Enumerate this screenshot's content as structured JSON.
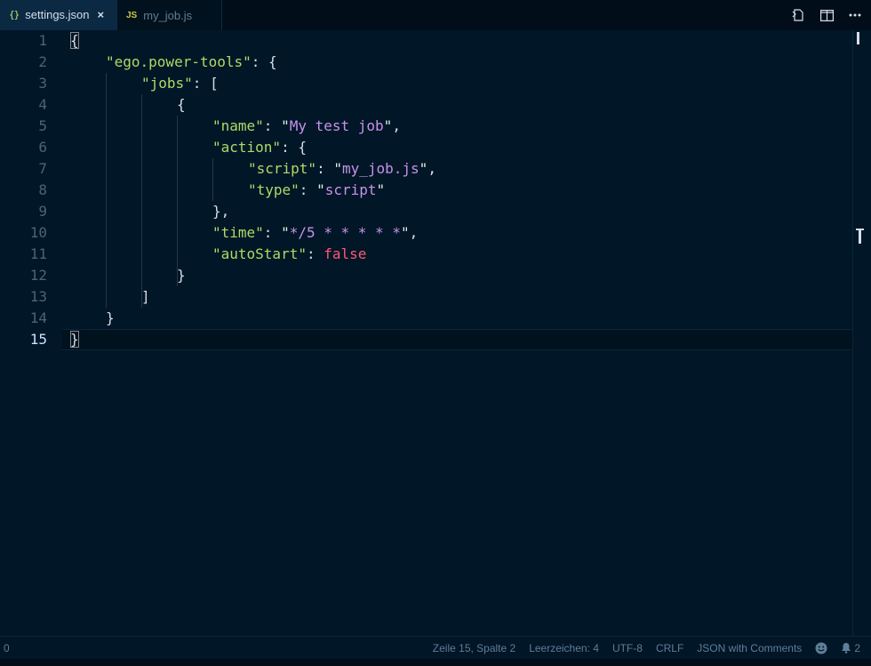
{
  "tabs": [
    {
      "icon": "{}",
      "label": "settings.json",
      "close": "×"
    },
    {
      "icon": "JS",
      "label": "my_job.js"
    }
  ],
  "actions": [
    "open-preview-icon",
    "split-editor-icon",
    "more-actions-icon"
  ],
  "editor": {
    "current_line": 15,
    "line_numbers": [
      "1",
      "2",
      "3",
      "4",
      "5",
      "6",
      "7",
      "8",
      "9",
      "10",
      "11",
      "12",
      "13",
      "14",
      "15"
    ],
    "code": {
      "l1": "{",
      "l2_key": "\"ego.power-tools\"",
      "l2_rest": ": {",
      "l3_key": "\"jobs\"",
      "l3_rest": ": [",
      "l4": "{",
      "l5_key": "\"name\"",
      "l5_colon": ": ",
      "l5_val": "My test job",
      "l5_end": ",",
      "l6_key": "\"action\"",
      "l6_rest": ": {",
      "l7_key": "\"script\"",
      "l7_colon": ": ",
      "l7_val": "my_job.js",
      "l7_end": ",",
      "l8_key": "\"type\"",
      "l8_colon": ": ",
      "l8_val": "script",
      "l9": "},",
      "l10_key": "\"time\"",
      "l10_colon": ": ",
      "l10_val": "*/5 * * * * *",
      "l10_end": ",",
      "l11_key": "\"autoStart\"",
      "l11_colon": ": ",
      "l11_val": "false",
      "l12": "}",
      "l13": "]",
      "l14": "}",
      "l15": "}"
    },
    "quote": "\""
  },
  "status": {
    "left": "0",
    "position": "Zeile 15, Spalte 2",
    "indent": "Leerzeichen: 4",
    "encoding": "UTF-8",
    "eol": "CRLF",
    "language": "JSON with Comments",
    "notifications": "2"
  },
  "colors": {
    "background": "#011627",
    "key": "#addb67",
    "string": "#c792ea",
    "boolean": "#ff5874",
    "line_number": "#4b6479"
  }
}
